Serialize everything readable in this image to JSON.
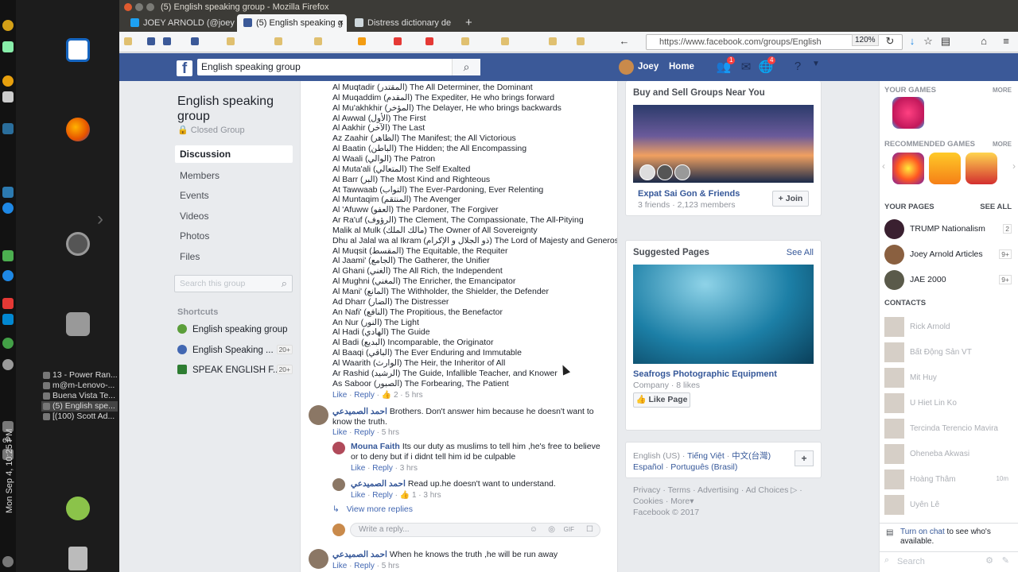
{
  "system": {
    "clock": "Mon Sep 4, 10:25 PM",
    "lang": "en",
    "tasks": [
      {
        "label": "13 - Power Ran..."
      },
      {
        "label": "m@m-Lenovo-..."
      },
      {
        "label": "Buena Vista Te..."
      },
      {
        "label": "(5) English spe..."
      },
      {
        "label": "[(100) Scott Ad..."
      }
    ]
  },
  "browser": {
    "window_title": "(5) English speaking group - Mozilla Firefox",
    "tabs": [
      {
        "label": "JOEY ARNOLD (@joey",
        "favicon_color": "#1da1f2"
      },
      {
        "label": "(5) English speaking g",
        "favicon_color": "#3b5998"
      },
      {
        "label": "Distress dictionary de",
        "favicon_color": "#cfd8dc"
      }
    ],
    "new_tab": "+",
    "close_tab": "×",
    "url": "https://www.facebook.com/groups/English",
    "zoom": "120%",
    "bookmarks": [
      "!",
      "J",
      "R",
      "H",
      "SC",
      "BTC",
      "G",
      "WOW",
      "NEW",
      "T",
      "W",
      "E",
      "EB"
    ]
  },
  "facebook": {
    "logo": "f",
    "search_value": "English speaking group",
    "user_name": "Joey",
    "home_label": "Home",
    "friend_badge": "1",
    "notif_badge": "4"
  },
  "group": {
    "name": "English speaking group",
    "privacy": "Closed Group",
    "nav": [
      "Discussion",
      "Members",
      "Events",
      "Videos",
      "Photos",
      "Files"
    ],
    "search_placeholder": "Search this group",
    "shortcuts_title": "Shortcuts",
    "shortcuts": [
      {
        "label": "English speaking group",
        "count": ""
      },
      {
        "label": "English Speaking ...",
        "count": "20+"
      },
      {
        "label": "SPEAK ENGLISH F...",
        "count": "20+"
      }
    ]
  },
  "post": {
    "names": [
      "Al Muqtadir (المقتدر) The All Determiner, the Dominant",
      "Al Muqaddim (المقدم) The Expediter, He who brings forward",
      "Al Mu'akhkhir (المؤخر) The Delayer, He who brings backwards",
      "Al Awwal (الأول) The First",
      "Al Aakhir (الآخر) The Last",
      "Az Zaahir (الظاهر) The Manifest; the All Victorious",
      "Al Baatin (الباطن) The Hidden; the All Encompassing",
      "Al Waali (الوالي) The Patron",
      "Al Muta'ali (المتعالي) The Self Exalted",
      "Al Barr (البر) The Most Kind and Righteous",
      "At Tawwaab (التواب) The Ever-Pardoning, Ever Relenting",
      "Al Muntaqim (المنتقم) The Avenger",
      "Al 'Afuww (العفو) The Pardoner, The Forgiver",
      "Ar Ra'uf (الرؤوف) The Clement, The Compassionate, The All-Pitying",
      "Malik al Mulk (مالك الملك) The Owner of All Sovereignty",
      "Dhu al Jalal wa al Ikram (ذو الجلال و الإكرام) The Lord of Majesty and Generosity",
      "Al Muqsit (المقسط) The Equitable, the Requiter",
      "Al Jaami' (الجامع) The Gatherer, the Unifier",
      "Al Ghani (الغني) The All Rich, the Independent",
      "Al Mughni (المغني) The Enricher, the Emancipator",
      "Al Mani' (المانع) The Withholder, the Shielder, the Defender",
      "Ad Dharr (الضار) The Distresser",
      "An Nafi' (النافع) The Propitious, the Benefactor",
      "An Nur (النور) The Light",
      "Al Hadi (الهادي) The Guide",
      "Al Badi (البديع) Incomparable, the Originator",
      "Al Baaqi (الباقي) The Ever Enduring and Immutable",
      "Al Waarith (الوارث) The Heir, the Inheritor of All",
      "Ar Rashid (الرشيد) The Guide, Infallible Teacher, and Knower",
      "As Saboor (الصبور) The Forbearing, The Patient"
    ],
    "like": "Like",
    "reply": "Reply",
    "likes": "2",
    "time": "5 hrs"
  },
  "comments": [
    {
      "author": "احمد الصميدعي",
      "text": "Brothers. Don't answer him because he doesn't want to know the truth.",
      "time": "5 hrs",
      "likes": ""
    },
    {
      "author": "Mouna Faith",
      "text": "Its our duty as muslims to tell him ,he's free to believe or to deny but if i didnt tell him id be culpable",
      "time": "3 hrs",
      "likes": ""
    },
    {
      "author": "احمد الصميدعي",
      "text": "Read up.he doesn't want to understand.",
      "time": "3 hrs",
      "likes": "1"
    },
    {
      "author": "احمد الصميدعي",
      "text": "When he knows the truth ,he will be run away",
      "time": "5 hrs",
      "likes": ""
    }
  ],
  "view_more": "View more replies",
  "reply_placeholder": "Write a reply...",
  "right": {
    "buy_sell_title": "Buy and Sell Groups Near You",
    "bs_group": "Expat Sai Gon & Friends",
    "bs_meta": "3 friends · 2,123 members",
    "join": "Join",
    "suggested_title": "Suggested Pages",
    "see_all": "See All",
    "page_name": "Seafrogs Photographic Equipment",
    "page_meta": "Company · 8 likes",
    "like_page": "Like Page",
    "languages": [
      "English (US)",
      "Tiếng Việt",
      "中文(台灣)",
      "Español",
      "Português (Brasil)"
    ],
    "footer_links": [
      "Privacy",
      "Terms",
      "Advertising",
      "Ad Choices",
      "Cookies",
      "More"
    ],
    "copyright": "Facebook © 2017"
  },
  "chat": {
    "your_games": "YOUR GAMES",
    "recommended_games": "RECOMMENDED GAMES",
    "more": "MORE",
    "your_pages": "YOUR PAGES",
    "see_all": "SEE ALL",
    "pages": [
      {
        "name": "TRUMP Nationalism O...",
        "count": "2"
      },
      {
        "name": "Joey Arnold Articles",
        "count": "9+"
      },
      {
        "name": "JAE 2000",
        "count": "9+"
      }
    ],
    "contacts_title": "CONTACTS",
    "contacts": [
      "Rick Arnold",
      "Bất Động Sản VT",
      "Mit Huy",
      "U Hiet Lin Ko",
      "Tercinda Terencio Mavira",
      "Oheneba Akwasi",
      "Hoàng Thâm",
      "Uyên Lê"
    ],
    "contacts_time": "10m",
    "turn_on": "Turn on chat",
    "turn_on_rest": " to see who's available.",
    "search_placeholder": "Search"
  },
  "colors": {
    "fb_blue": "#3b5998",
    "link": "#365899"
  }
}
